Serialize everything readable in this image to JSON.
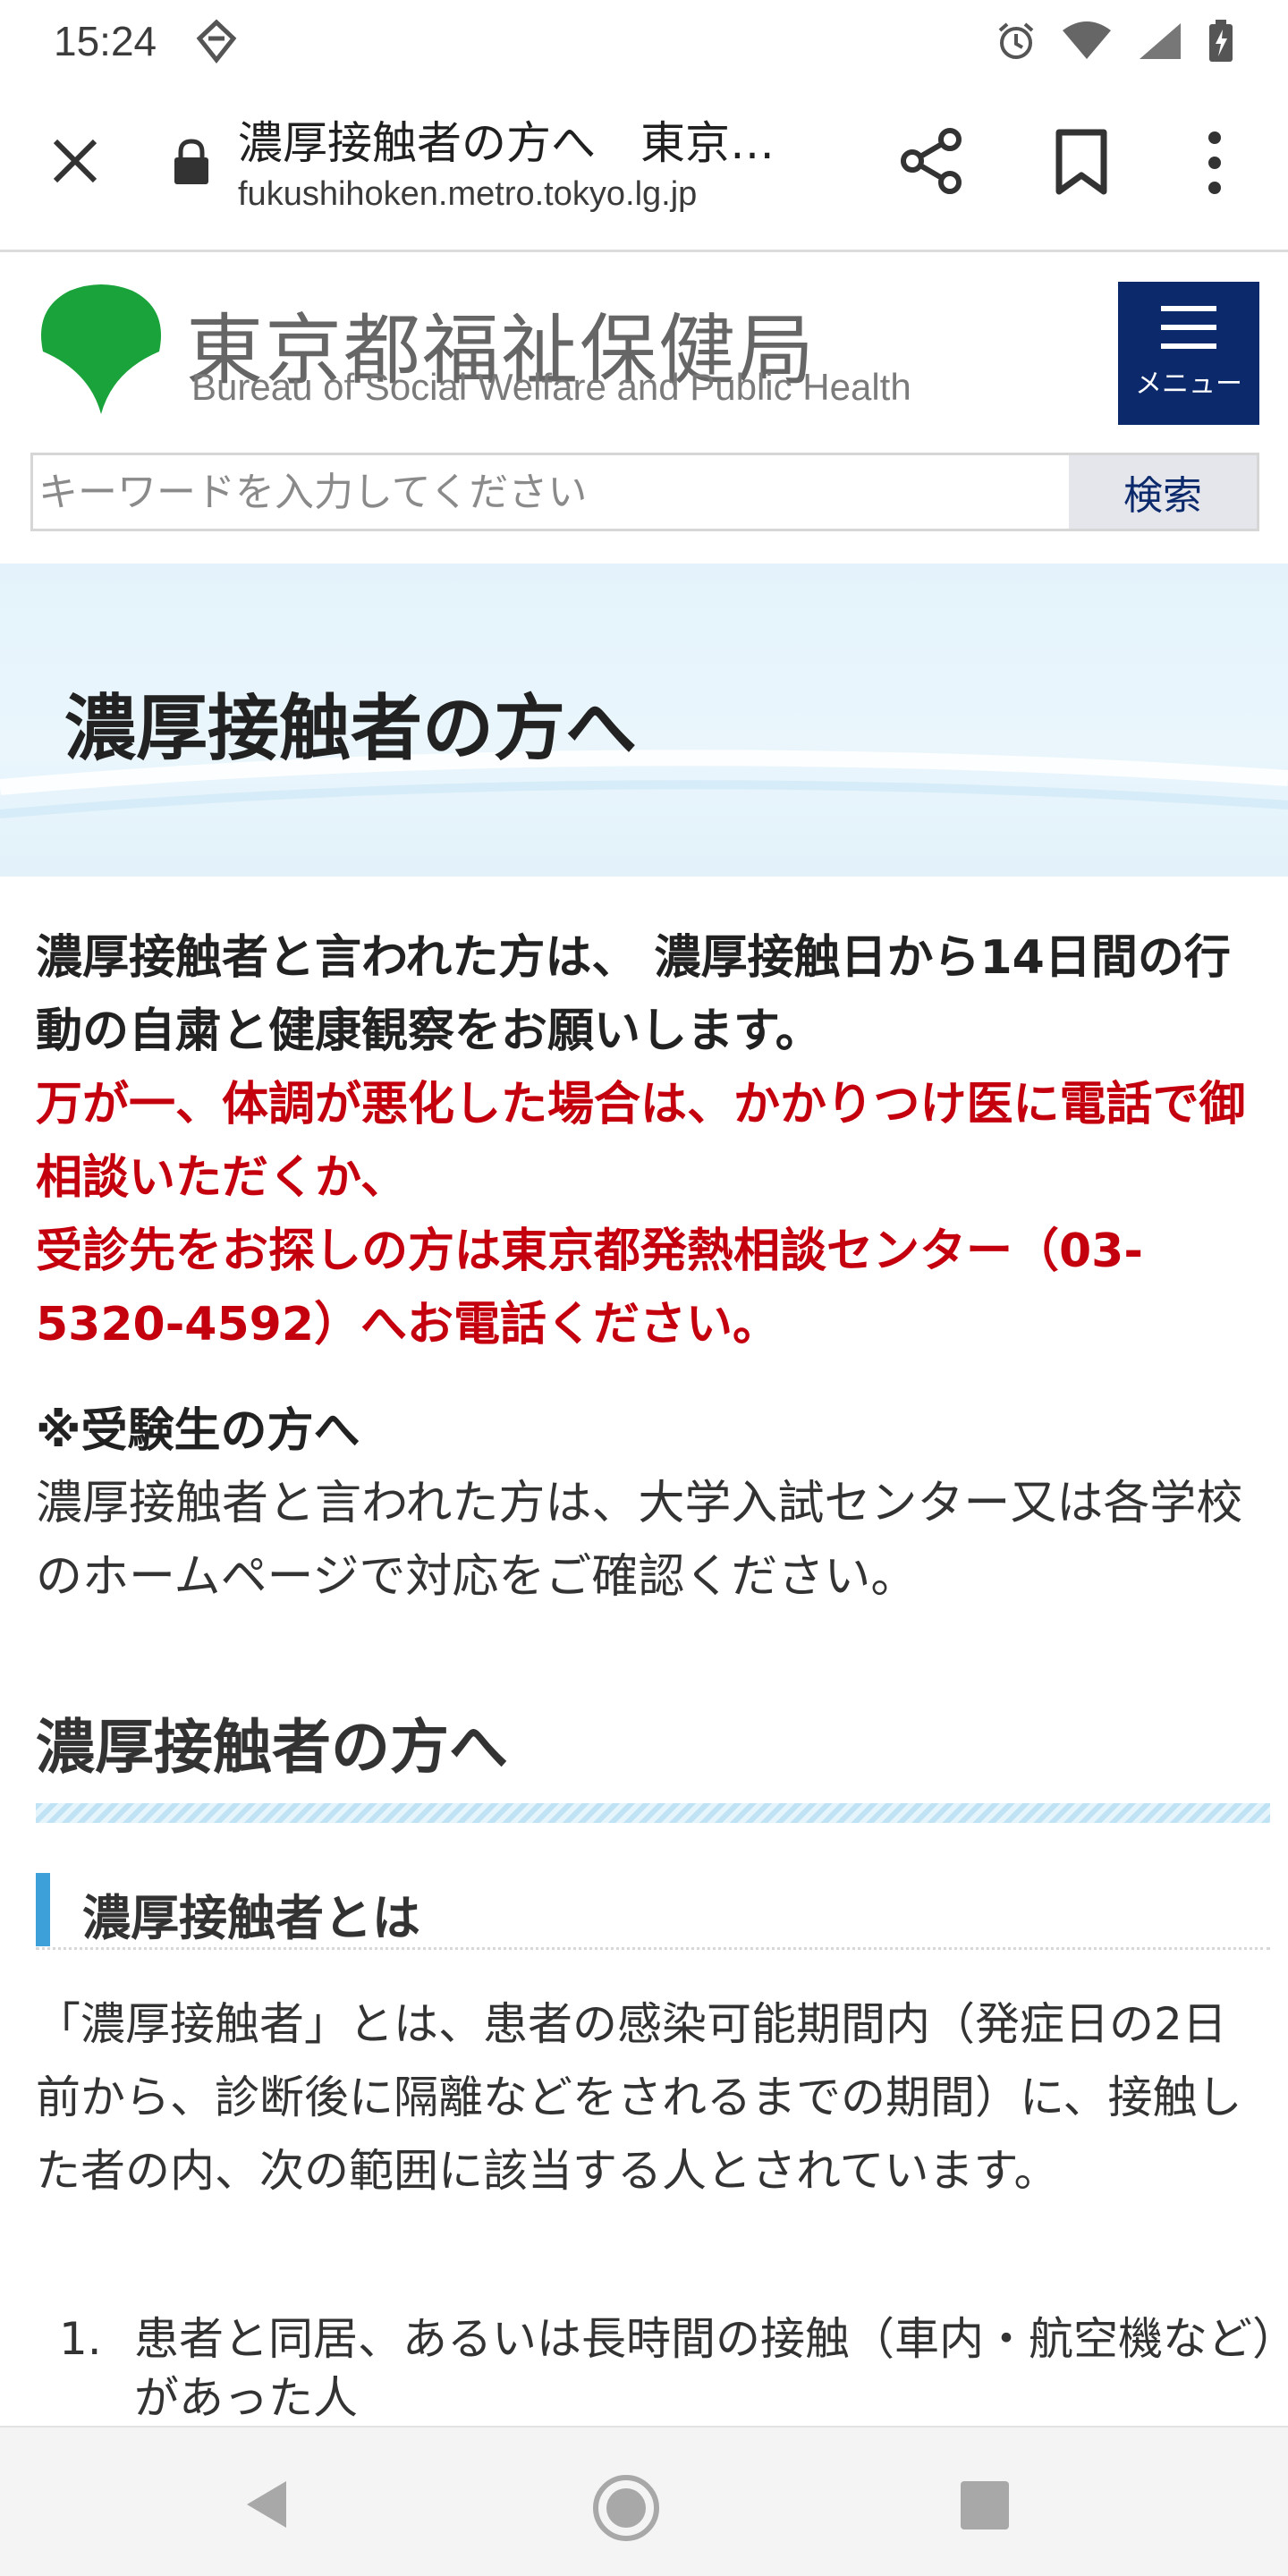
{
  "status_bar": {
    "time": "15:24"
  },
  "toolbar": {
    "title": "濃厚接触者の方へ　東京…",
    "url": "fukushihoken.metro.tokyo.lg.jp"
  },
  "site": {
    "name_jp": "東京都福祉保健局",
    "name_en": "Bureau of Social Welfare and Public Health",
    "menu_label": "メニュー",
    "brand_color": "#0c2a6b",
    "logo_color": "#1aa33a"
  },
  "search": {
    "placeholder": "キーワードを入力してください",
    "button_label": "検索"
  },
  "hero": {
    "title": "濃厚接触者の方へ"
  },
  "intro": {
    "lead": "濃厚接触者と言われた方は、 濃厚接触日から14日間の行動の自粛と健康観察をお願いします。",
    "warning_1": "万が一、体調が悪化した場合は、かかりつけ医に電話で御相談いただくか、",
    "warning_2": "受診先をお探しの方は東京都発熱相談センター（03-5320-4592）へお電話ください。",
    "warning_color": "#c4000f",
    "note_heading": "※受験生の方へ",
    "note_body": "濃厚接触者と言われた方は、大学入試センター又は各学校のホームページで対応をご確認ください。"
  },
  "section": {
    "heading": "濃厚接触者の方へ",
    "subheading": "濃厚接触者とは",
    "paragraph": "「濃厚接触者」とは、患者の感染可能期間内（発症日の2日前から、診断後に隔離などをされるまでの期間）に、接触した者の内、次の範囲に該当する人とされています。",
    "list": [
      {
        "num": "1.",
        "text": "患者と同居、あるいは長時間の接触（車内・航空機など）があった人"
      }
    ]
  }
}
